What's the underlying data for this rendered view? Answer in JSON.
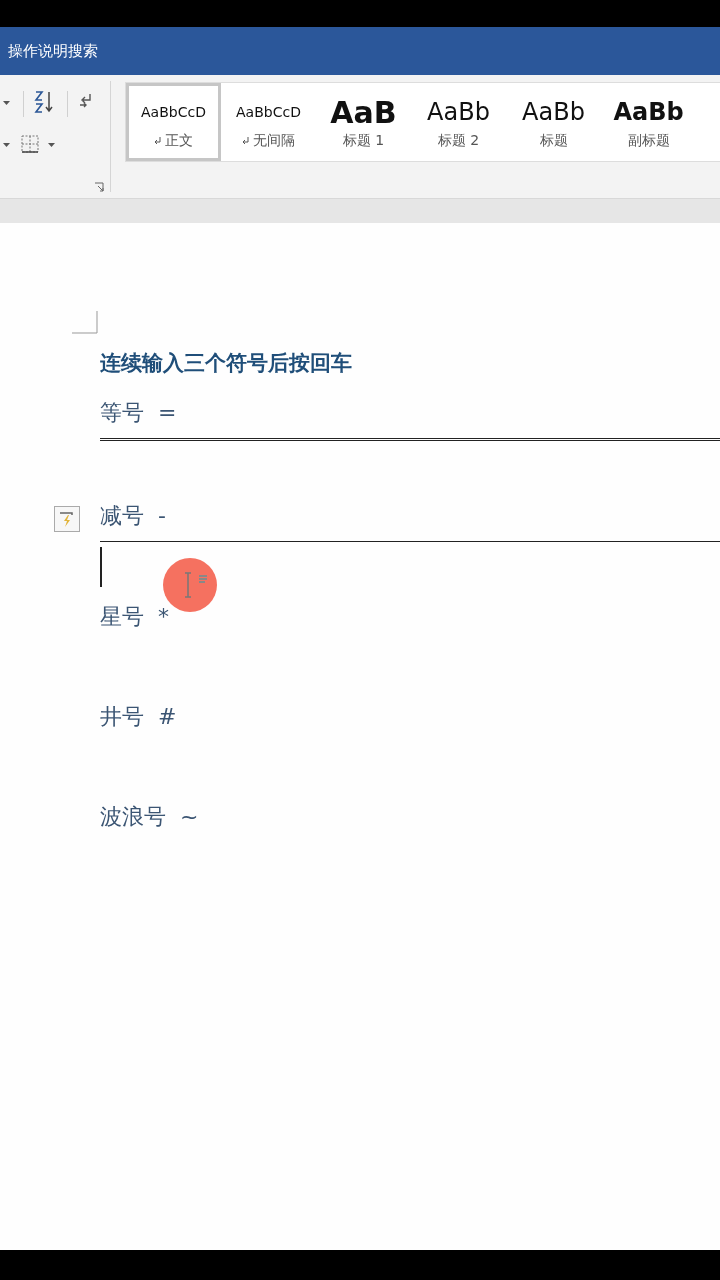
{
  "window": {
    "search_label": "操作说明搜索"
  },
  "styles_gallery": [
    {
      "kind": "body",
      "sample": "AaBbCcD",
      "label": "正文",
      "linked": true,
      "selected": true
    },
    {
      "kind": "body",
      "sample": "AaBbCcD",
      "label": "无间隔",
      "linked": true,
      "selected": false
    },
    {
      "kind": "heading1",
      "sample": "AaB",
      "label": "标题 1",
      "linked": false,
      "selected": false
    },
    {
      "kind": "heading2",
      "sample": "AaBb",
      "label": "标题 2",
      "linked": false,
      "selected": false
    },
    {
      "kind": "title",
      "sample": "AaBb",
      "label": "标题",
      "linked": false,
      "selected": false
    },
    {
      "kind": "subtitle",
      "sample": "AaBb",
      "label": "副标题",
      "linked": false,
      "selected": false
    }
  ],
  "document": {
    "paragraphs": [
      {
        "kind": "heading",
        "text": "连续输入三个符号后按回车"
      },
      {
        "kind": "text",
        "text": "等号  ="
      },
      {
        "kind": "double_rule"
      },
      {
        "kind": "blank"
      },
      {
        "kind": "text",
        "text": "减号  -",
        "autocorrect": true
      },
      {
        "kind": "single_rule"
      },
      {
        "kind": "blank",
        "cursor": true
      },
      {
        "kind": "text",
        "text": "星号  *"
      },
      {
        "kind": "blank"
      },
      {
        "kind": "text",
        "text": "井号  #"
      },
      {
        "kind": "blank"
      },
      {
        "kind": "text",
        "text": "波浪号  ~"
      }
    ]
  }
}
